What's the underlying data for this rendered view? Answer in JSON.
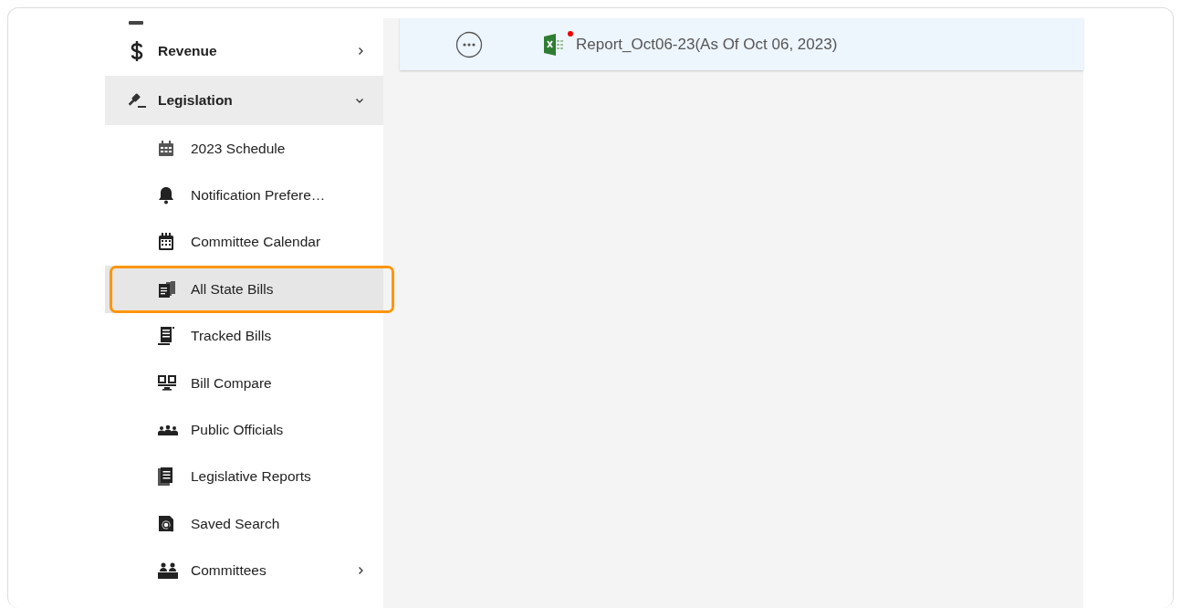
{
  "sidebar": {
    "items": [
      {
        "label": "Revenue",
        "kind": "group",
        "expanded": false,
        "selected": false
      },
      {
        "label": "Legislation",
        "kind": "group",
        "expanded": true,
        "selected": true,
        "children": [
          {
            "label": "2023 Schedule",
            "kind": "link",
            "selected": false,
            "highlighted": false
          },
          {
            "label": "Notification Prefere…",
            "kind": "link",
            "selected": false,
            "highlighted": false
          },
          {
            "label": "Committee Calendar",
            "kind": "link",
            "selected": false,
            "highlighted": false
          },
          {
            "label": "All State Bills",
            "kind": "link",
            "selected": true,
            "highlighted": true
          },
          {
            "label": "Tracked Bills",
            "kind": "link",
            "selected": false,
            "highlighted": false
          },
          {
            "label": "Bill Compare",
            "kind": "link",
            "selected": false,
            "highlighted": false
          },
          {
            "label": "Public Officials",
            "kind": "link",
            "selected": false,
            "highlighted": false
          },
          {
            "label": "Legislative Reports",
            "kind": "link",
            "selected": false,
            "highlighted": false
          },
          {
            "label": "Saved Search",
            "kind": "link",
            "selected": false,
            "highlighted": false
          },
          {
            "label": "Committees",
            "kind": "group",
            "expanded": false,
            "selected": false,
            "highlighted": false
          }
        ]
      }
    ]
  },
  "report": {
    "file_name": "Report_Oct06-23(As Of Oct 06, 2023)",
    "unread": true
  }
}
